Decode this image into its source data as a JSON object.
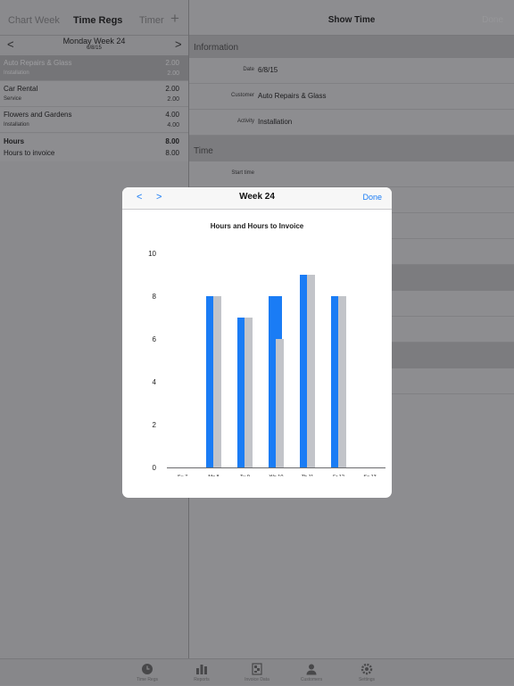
{
  "left_nav": {
    "chart": "Chart",
    "week": "Week",
    "title": "Time Regs",
    "timer": "Timer",
    "add_glyph": "+"
  },
  "date_header": {
    "prev_glyph": "<",
    "next_glyph": ">",
    "title": "Monday Week 24",
    "date": "6/8/15"
  },
  "entries": [
    {
      "customer": "Auto Repairs & Glass",
      "activity": "Installation",
      "hours": "2.00",
      "invoice": "2.00",
      "selected": true
    },
    {
      "customer": "Car Rental",
      "activity": "Service",
      "hours": "2.00",
      "invoice": "2.00",
      "selected": false
    },
    {
      "customer": "Flowers and Gardens",
      "activity": "Installation",
      "hours": "4.00",
      "invoice": "4.00",
      "selected": false
    }
  ],
  "totals": {
    "hours_label": "Hours",
    "hours_value": "8.00",
    "invoice_label": "Hours to invoice",
    "invoice_value": "8.00"
  },
  "right_nav": {
    "title": "Show Time",
    "done": "Done"
  },
  "info": {
    "section": "Information",
    "date_label": "Date",
    "date_value": "6/8/15",
    "customer_label": "Customer",
    "customer_value": "Auto Repairs & Glass",
    "activity_label": "Activity",
    "activity_value": "Installation"
  },
  "time": {
    "section": "Time",
    "start_label": "Start time"
  },
  "tabs": [
    {
      "label": "Time Regs",
      "icon": "clock-icon"
    },
    {
      "label": "Reports",
      "icon": "bar-chart-icon"
    },
    {
      "label": "Invoice Data",
      "icon": "invoice-icon"
    },
    {
      "label": "Customers",
      "icon": "person-icon"
    },
    {
      "label": "Settings",
      "icon": "gear-icon"
    }
  ],
  "popup": {
    "prev": "<",
    "next": ">",
    "title": "Week 24",
    "done": "Done"
  },
  "colors": {
    "accent": "#1a7cf5",
    "hours_bar": "#1a7cf5",
    "invoice_bar": "#c2c4c9"
  },
  "chart_data": {
    "type": "bar",
    "title": "Hours and Hours to Invoice",
    "categories": [
      "Su 7",
      "Mo 8",
      "Tu 9",
      "We 10",
      "Th 11",
      "Fr 12",
      "Sa 13"
    ],
    "series": [
      {
        "values": [
          0,
          8,
          7,
          8,
          9,
          8,
          0
        ]
      },
      {
        "values": [
          0,
          8,
          7,
          6,
          9,
          8,
          0
        ]
      }
    ],
    "ylim": [
      0,
      10
    ],
    "yticks": [
      0,
      2,
      4,
      6,
      8,
      10
    ],
    "grid": false,
    "legend": "none"
  }
}
